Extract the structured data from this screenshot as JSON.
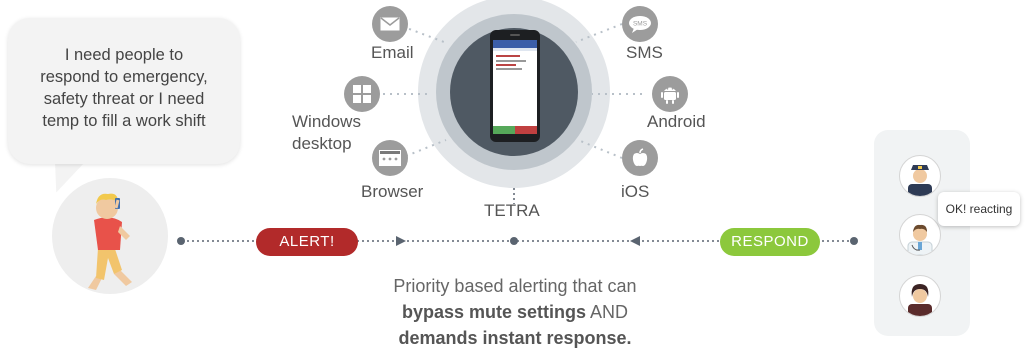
{
  "speech": {
    "line1": "I need people to",
    "line2": "respond to emergency,",
    "line3": "safety threat or I need",
    "line4": "temp to fill a work shift"
  },
  "channels": {
    "email": "Email",
    "windows_line1": "Windows",
    "windows_line2": "desktop",
    "browser": "Browser",
    "tetra": "TETRA",
    "sms": "SMS",
    "android": "Android",
    "ios": "iOS"
  },
  "icons": {
    "email": "envelope-icon",
    "windows": "windows-icon",
    "browser": "browser-icon",
    "sms": "sms-bubble-icon",
    "android": "android-icon",
    "ios": "apple-icon",
    "sms_glyph": "SMS"
  },
  "flow": {
    "alert_label": "ALERT!",
    "respond_label": "RESPOND"
  },
  "responders": {
    "reply": "OK! reacting"
  },
  "caption": {
    "line1": "Priority based alerting that can",
    "line2_bold": "bypass mute settings",
    "line2_rest": " AND",
    "line3_bold": "demands instant response."
  },
  "colors": {
    "alert": "#b22a2a",
    "respond": "#8cc83c",
    "icon_gray": "#9c9c9c",
    "ring_outer": "#e3e6e9",
    "ring_mid": "#bfc6cc",
    "ring_inner": "#4f5963"
  }
}
